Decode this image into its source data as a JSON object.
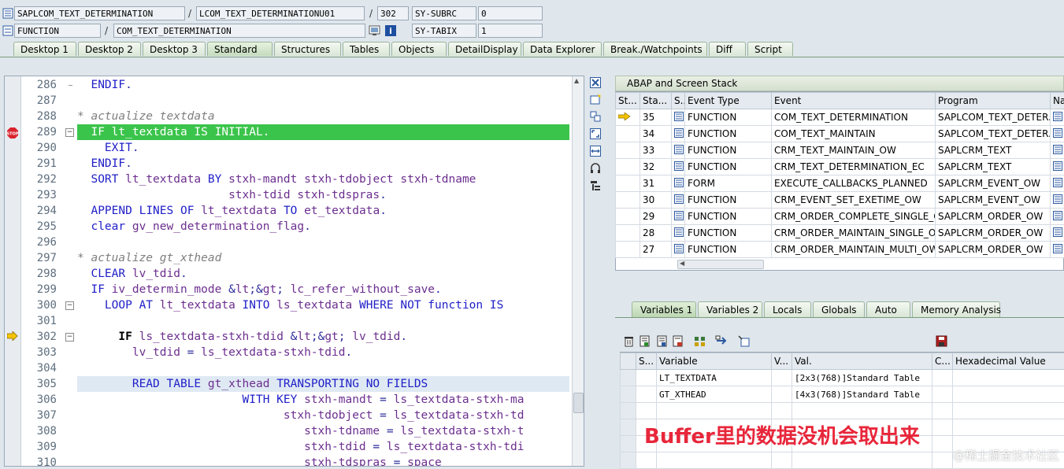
{
  "header": {
    "program": "SAPLCOM_TEXT_DETERMINATION",
    "include": "LCOM_TEXT_DETERMINATIONU01",
    "line": "302",
    "sysvar1_name": "SY-SUBRC",
    "sysvar1_value": "0",
    "type": "FUNCTION",
    "object": "COM_TEXT_DETERMINATION",
    "sysvar2_name": "SY-TABIX",
    "sysvar2_value": "1",
    "sep": "/"
  },
  "tabs": [
    "Desktop 1",
    "Desktop 2",
    "Desktop 3",
    "Standard",
    "Structures",
    "Tables",
    "Objects",
    "DetailDisplay",
    "Data Explorer",
    "Break./Watchpoints",
    "Diff",
    "Script"
  ],
  "active_tab": "Standard",
  "code": [
    {
      "n": "286",
      "t": "  ENDIF."
    },
    {
      "n": "287",
      "t": ""
    },
    {
      "n": "288",
      "t": "* actualize textdata"
    },
    {
      "n": "289",
      "t": "  IF lt_textdata IS INITIAL."
    },
    {
      "n": "290",
      "t": "    EXIT."
    },
    {
      "n": "291",
      "t": "  ENDIF."
    },
    {
      "n": "292",
      "t": "  SORT lt_textdata BY stxh-mandt stxh-tdobject stxh-tdname"
    },
    {
      "n": "293",
      "t": "                      stxh-tdid stxh-tdspras."
    },
    {
      "n": "294",
      "t": "  APPEND LINES OF lt_textdata TO et_textdata."
    },
    {
      "n": "295",
      "t": "  clear gv_new_determination_flag."
    },
    {
      "n": "296",
      "t": ""
    },
    {
      "n": "297",
      "t": "* actualize gt_xthead"
    },
    {
      "n": "298",
      "t": "  CLEAR lv_tdid."
    },
    {
      "n": "299",
      "t": "  IF iv_determin_mode <> lc_refer_without_save."
    },
    {
      "n": "300",
      "t": "    LOOP AT lt_textdata INTO ls_textdata WHERE NOT function IS"
    },
    {
      "n": "301",
      "t": ""
    },
    {
      "n": "302",
      "t": "      IF ls_textdata-stxh-tdid <> lv_tdid."
    },
    {
      "n": "303",
      "t": "        lv_tdid = ls_textdata-stxh-tdid."
    },
    {
      "n": "304",
      "t": ""
    },
    {
      "n": "305",
      "t": "        READ TABLE gt_xthead TRANSPORTING NO FIELDS"
    },
    {
      "n": "306",
      "t": "                        WITH KEY stxh-mandt = ls_textdata-stxh-ma"
    },
    {
      "n": "307",
      "t": "                              stxh-tdobject = ls_textdata-stxh-td"
    },
    {
      "n": "308",
      "t": "                                 stxh-tdname = ls_textdata-stxh-t"
    },
    {
      "n": "309",
      "t": "                                 stxh-tdid = ls_textdata-stxh-tdi"
    },
    {
      "n": "310",
      "t": "                                 stxh-tdspras = space"
    }
  ],
  "stack": {
    "title": "ABAP and Screen Stack",
    "columns": [
      "St...",
      "Sta...",
      "S...",
      "Event Type",
      "Event",
      "Program",
      "Na"
    ],
    "rows": [
      {
        "level": "35",
        "type": "FUNCTION",
        "event": "COM_TEXT_DETERMINATION",
        "program": "SAPLCOM_TEXT_DETER..."
      },
      {
        "level": "34",
        "type": "FUNCTION",
        "event": "COM_TEXT_MAINTAIN",
        "program": "SAPLCOM_TEXT_DETER..."
      },
      {
        "level": "33",
        "type": "FUNCTION",
        "event": "CRM_TEXT_MAINTAIN_OW",
        "program": "SAPLCRM_TEXT"
      },
      {
        "level": "32",
        "type": "FUNCTION",
        "event": "CRM_TEXT_DETERMINATION_EC",
        "program": "SAPLCRM_TEXT"
      },
      {
        "level": "31",
        "type": "FORM",
        "event": "EXECUTE_CALLBACKS_PLANNED",
        "program": "SAPLCRM_EVENT_OW"
      },
      {
        "level": "30",
        "type": "FUNCTION",
        "event": "CRM_EVENT_SET_EXETIME_OW",
        "program": "SAPLCRM_EVENT_OW"
      },
      {
        "level": "29",
        "type": "FUNCTION",
        "event": "CRM_ORDER_COMPLETE_SINGLE_O...",
        "program": "SAPLCRM_ORDER_OW"
      },
      {
        "level": "28",
        "type": "FUNCTION",
        "event": "CRM_ORDER_MAINTAIN_SINGLE_OW",
        "program": "SAPLCRM_ORDER_OW"
      },
      {
        "level": "27",
        "type": "FUNCTION",
        "event": "CRM_ORDER_MAINTAIN_MULTI_OW",
        "program": "SAPLCRM_ORDER_OW"
      }
    ]
  },
  "var_tabs": [
    "Variables 1",
    "Variables 2",
    "Locals",
    "Globals",
    "Auto",
    "Memory Analysis"
  ],
  "vars": {
    "columns": [
      "S...",
      "Variable",
      "V...",
      "Val.",
      "C...",
      "Hexadecimal Value"
    ],
    "rows": [
      {
        "name": "LT_TEXTDATA",
        "value": "[2x3(768)]Standard Table"
      },
      {
        "name": "GT_XTHEAD",
        "value": "[4x3(768)]Standard Table"
      }
    ]
  },
  "annotation": "Buffer里的数据没机会取出来",
  "watermark": "@稀土掘金技术社区",
  "colors": {
    "highlight": "#3bc44b",
    "annotation": "#e8263a",
    "keyword": "#2020c8"
  }
}
